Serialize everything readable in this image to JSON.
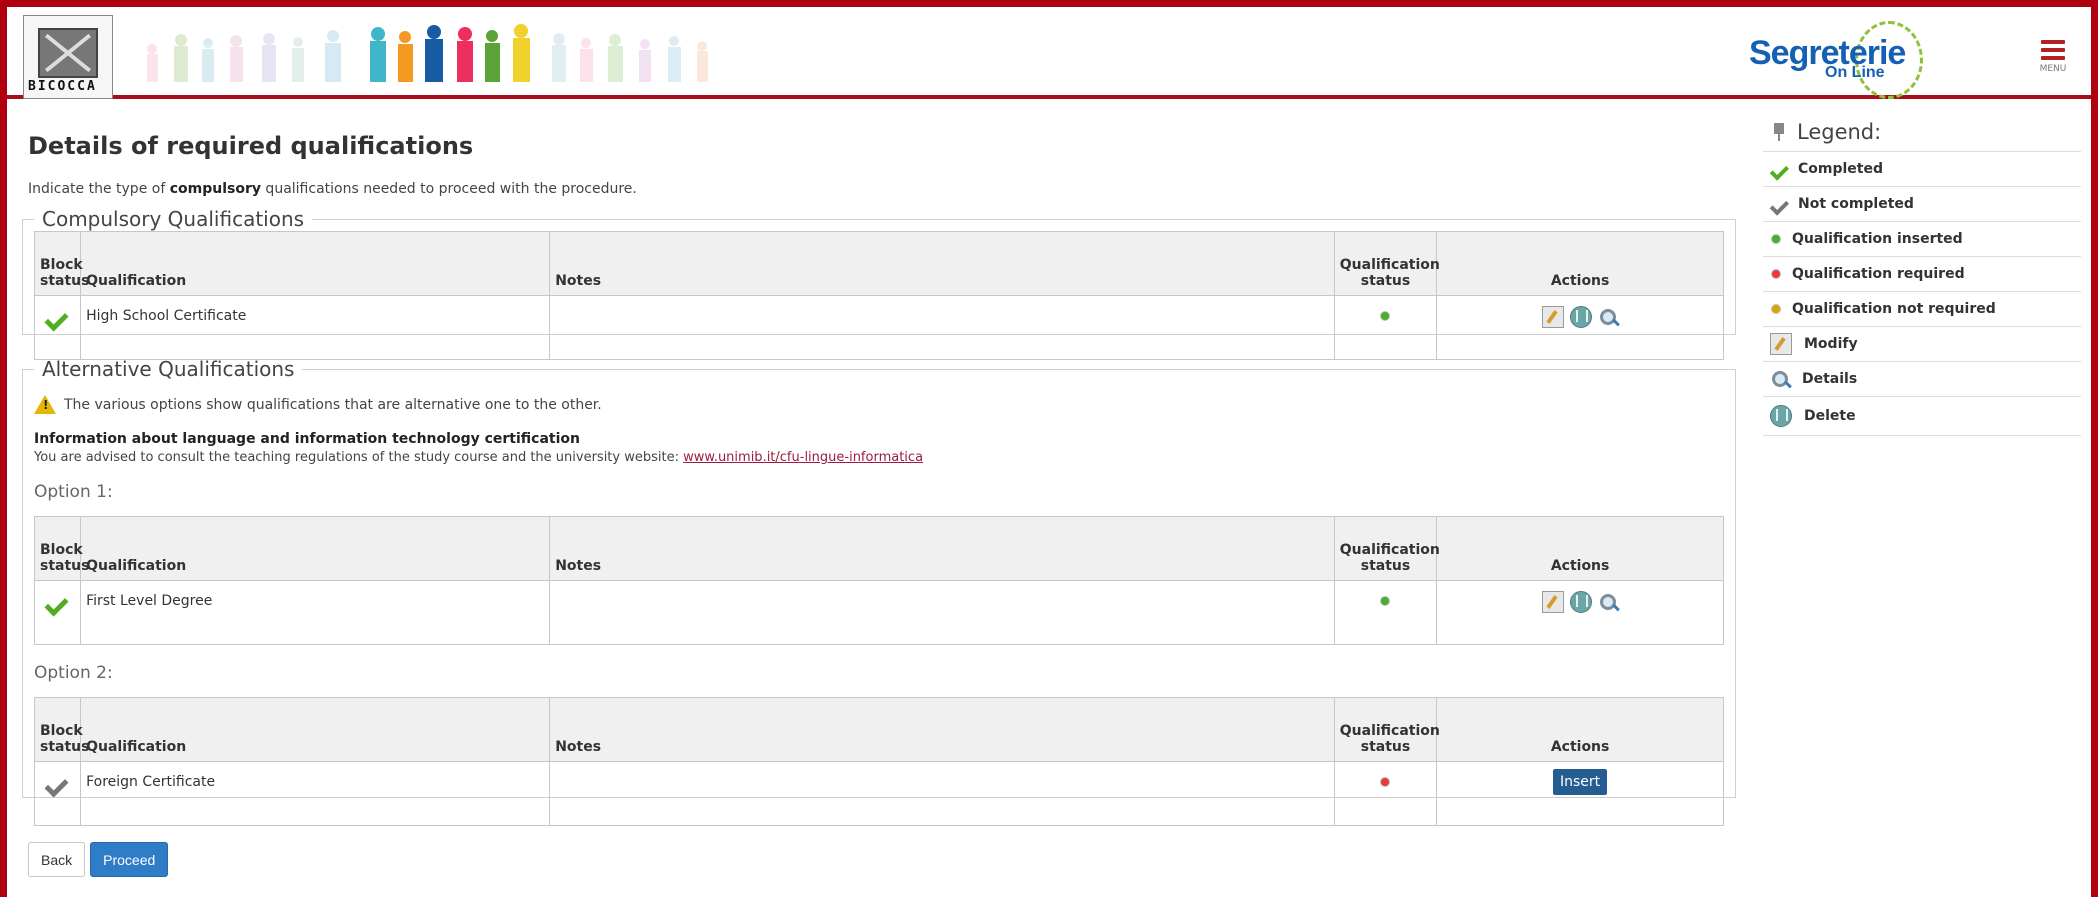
{
  "header": {
    "university_logo_text": "BICOCCA",
    "brand_name": "Segreterie",
    "brand_subtitle": "On Line",
    "menu_label": "MENU"
  },
  "main": {
    "title": "Details of required qualifications",
    "intro_prefix": "Indicate the type of ",
    "intro_bold": "compulsory",
    "intro_suffix": " qualifications needed to proceed with the procedure.",
    "compulsory": {
      "legend": "Compulsory Qualifications",
      "headers": {
        "block_status_line1": "Block",
        "block_status_line2": "status",
        "qualification": "Qualification",
        "notes": "Notes",
        "qualification_status_line1": "Qualification",
        "qualification_status_line2": "status",
        "actions": "Actions"
      },
      "rows": [
        {
          "qualification": "High School Certificate",
          "notes": "",
          "block_status": "completed",
          "qualification_status": "inserted"
        }
      ]
    },
    "alternative": {
      "legend": "Alternative Qualifications",
      "warning": "The various options show qualifications that are alternative one to the other.",
      "certification_title": "Information about language and information technology certification",
      "certification_text": "You are advised to consult the teaching regulations of the study course and the university website: ",
      "certification_link": "www.unimib.it/cfu-lingue-informatica",
      "options": [
        {
          "label": "Option 1:",
          "rows": [
            {
              "qualification": "First Level Degree",
              "notes": "",
              "block_status": "completed",
              "qualification_status": "inserted"
            }
          ]
        },
        {
          "label": "Option 2:",
          "rows": [
            {
              "qualification": "Foreign Certificate",
              "notes": "",
              "block_status": "not completed",
              "qualification_status": "required",
              "action_label": "Insert"
            }
          ]
        }
      ]
    },
    "buttons": {
      "back": "Back",
      "proceed": "Proceed"
    }
  },
  "legend": {
    "title": "Legend:",
    "items": [
      {
        "label": "Completed",
        "icon": "green-check-icon"
      },
      {
        "label": "Not completed",
        "icon": "gray-check-icon"
      },
      {
        "label": "Qualification inserted",
        "icon": "green-dot-icon"
      },
      {
        "label": "Qualification required",
        "icon": "red-dot-icon"
      },
      {
        "label": "Qualification not required",
        "icon": "yellow-dot-icon"
      },
      {
        "label": "Modify",
        "icon": "edit-icon"
      },
      {
        "label": "Details",
        "icon": "details-icon"
      },
      {
        "label": "Delete",
        "icon": "delete-icon"
      }
    ]
  },
  "colors": {
    "brand_red": "#b0000f",
    "inserted_green": "#4caf2a",
    "required_red": "#e83b3b",
    "not_required_yellow": "#d7a600",
    "button_blue": "#2f7dc6"
  }
}
